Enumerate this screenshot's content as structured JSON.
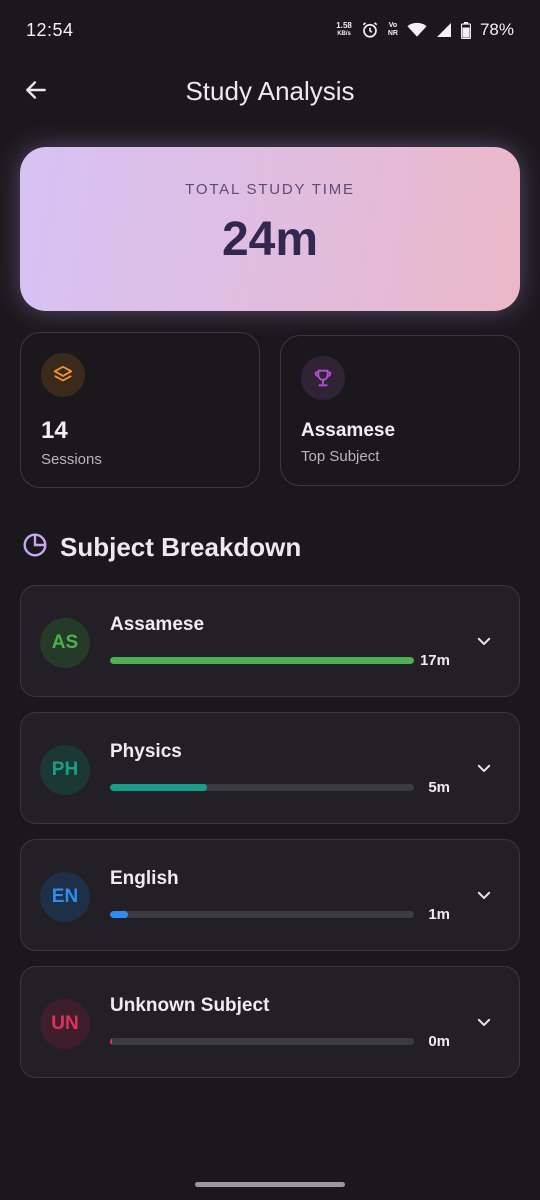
{
  "status_bar": {
    "time": "12:54",
    "net_speed_value": "1.58",
    "net_speed_unit": "KB/s",
    "volte_top": "Vo",
    "volte_bottom": "NR",
    "battery": "78%"
  },
  "header": {
    "title": "Study Analysis",
    "back_icon": "arrow-left-icon"
  },
  "hero": {
    "label": "TOTAL STUDY TIME",
    "value": "24m",
    "gradient": [
      "#d7c2f5",
      "#ecb8c8"
    ]
  },
  "stats": {
    "sessions": {
      "value": "14",
      "caption": "Sessions",
      "icon": "layers-icon",
      "color": "#f0962e"
    },
    "top_subject": {
      "value": "Assamese",
      "caption": "Top Subject",
      "icon": "trophy-icon",
      "color": "#b44fd6"
    }
  },
  "breakdown": {
    "title": "Subject Breakdown",
    "icon": "pie-chart-icon",
    "subjects": [
      {
        "initials": "AS",
        "name": "Assamese",
        "time": "17m",
        "progress": 1.0,
        "color": "#4caf50",
        "avatar_bg": "#253a28"
      },
      {
        "initials": "PH",
        "name": "Physics",
        "time": "5m",
        "progress": 0.32,
        "color": "#1a9e8c",
        "avatar_bg": "#1c3834"
      },
      {
        "initials": "EN",
        "name": "English",
        "time": "1m",
        "progress": 0.06,
        "color": "#2f8cf0",
        "avatar_bg": "#1f2f48"
      },
      {
        "initials": "UN",
        "name": "Unknown Subject",
        "time": "0m",
        "progress": 0.005,
        "color": "#e0315e",
        "avatar_bg": "#3f1e2c"
      }
    ]
  }
}
